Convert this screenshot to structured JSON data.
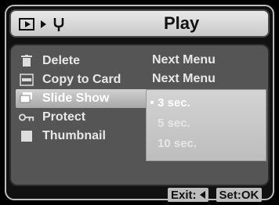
{
  "header": {
    "title": "Play",
    "mode_icon": "play-icon",
    "setup_icon": "tuning-fork-icon"
  },
  "menu": {
    "items": [
      {
        "label": "Delete",
        "icon": "trash-icon",
        "value": "Next Menu"
      },
      {
        "label": "Copy to Card",
        "icon": "copy-icon",
        "value": "Next Menu"
      },
      {
        "label": "Slide Show",
        "icon": "slideshow-icon",
        "value": ""
      },
      {
        "label": "Protect",
        "icon": "key-icon",
        "value": ""
      },
      {
        "label": "Thumbnail",
        "icon": "thumbnail-icon",
        "value": ""
      }
    ],
    "selected_index": 2
  },
  "slideshow_options": {
    "options": [
      "3 sec.",
      "5 sec.",
      "10 sec."
    ],
    "selected_index": 0
  },
  "footer": {
    "exit_label": "Exit:",
    "set_label": "Set:OK"
  },
  "colors": {
    "selection": "#bdbdbd",
    "background": "#555555",
    "header": "#d0d0d0"
  }
}
